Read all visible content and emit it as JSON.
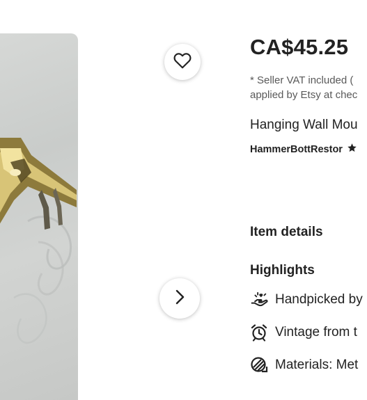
{
  "product": {
    "price": "CA$45.25",
    "vat_line1": "* Seller VAT included (",
    "vat_line2": "applied by Etsy at chec",
    "title": "Hanging Wall Mou",
    "shop_name": "HammerBottRestor"
  },
  "sections": {
    "item_details": "Item details",
    "highlights": "Highlights"
  },
  "highlights": [
    {
      "icon": "hand-heart-icon",
      "text": "Handpicked by"
    },
    {
      "icon": "alarm-clock-icon",
      "text": "Vintage from t"
    },
    {
      "icon": "materials-icon",
      "text": "Materials: Met"
    }
  ],
  "buttons": {
    "favorite_icon": "heart-icon",
    "next_icon": "chevron-right-icon"
  }
}
